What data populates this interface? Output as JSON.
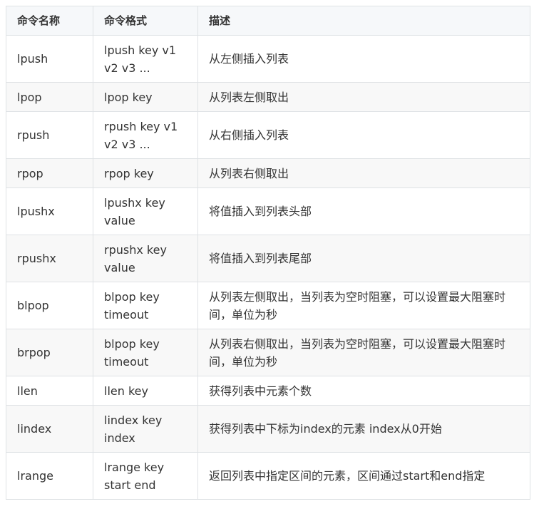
{
  "table": {
    "headers": [
      "命令名称",
      "命令格式",
      "描述"
    ],
    "rows": [
      {
        "name": "lpush",
        "format": "lpush key v1 v2 v3 ...",
        "desc": "从左侧插入列表"
      },
      {
        "name": "lpop",
        "format": "lpop key",
        "desc": "从列表左侧取出"
      },
      {
        "name": "rpush",
        "format": "rpush key v1 v2 v3 ...",
        "desc": "从右侧插入列表"
      },
      {
        "name": "rpop",
        "format": "rpop key",
        "desc": "从列表右侧取出"
      },
      {
        "name": "lpushx",
        "format": "lpushx key value",
        "desc": "将值插入到列表头部"
      },
      {
        "name": "rpushx",
        "format": "rpushx key value",
        "desc": "将值插入到列表尾部"
      },
      {
        "name": "blpop",
        "format": "blpop key timeout",
        "desc": "从列表左侧取出，当列表为空时阻塞，可以设置最大阻塞时间，单位为秒"
      },
      {
        "name": "brpop",
        "format": "blpop key timeout",
        "desc": "从列表右侧取出，当列表为空时阻塞，可以设置最大阻塞时间，单位为秒"
      },
      {
        "name": "llen",
        "format": "llen key",
        "desc": "获得列表中元素个数"
      },
      {
        "name": "lindex",
        "format": "lindex key index",
        "desc": "获得列表中下标为index的元素 index从0开始"
      },
      {
        "name": "lrange",
        "format": "lrange key start end",
        "desc": "返回列表中指定区间的元素，区间通过start和end指定"
      }
    ]
  }
}
